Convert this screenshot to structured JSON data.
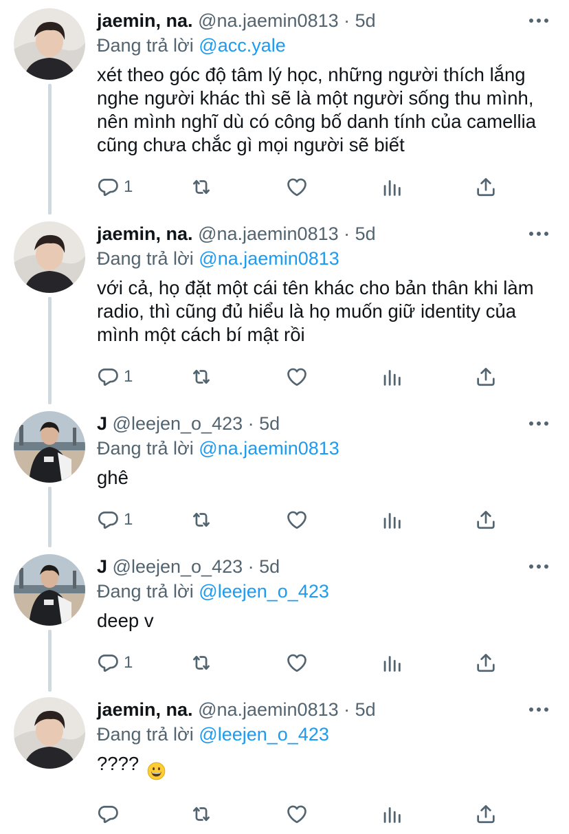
{
  "colors": {
    "text": "#0f1419",
    "secondary": "#536471",
    "link": "#1d9bf0",
    "thread_line": "#cfd9de"
  },
  "reply_prefix": "Đang trả lời",
  "tweets": [
    {
      "name": "jaemin, na.",
      "handle": "@na.jaemin0813",
      "time": "5d",
      "reply_to": "@acc.yale",
      "text": "xét theo góc độ tâm lý học, những người thích lắng nghe người khác thì sẽ là một người sống thu mình, nên mình nghĩ dù có công bố danh tính của camellia cũng chưa chắc gì mọi người sẽ biết",
      "reply_count": "1",
      "avatar": "avatar-jaemin"
    },
    {
      "name": "jaemin, na.",
      "handle": "@na.jaemin0813",
      "time": "5d",
      "reply_to": "@na.jaemin0813",
      "text": "với cả, họ đặt một cái tên khác cho bản thân khi làm radio, thì cũng đủ hiểu là họ muốn giữ identity của mình một cách bí mật rồi",
      "reply_count": "1",
      "avatar": "avatar-jaemin"
    },
    {
      "name": "J",
      "handle": "@leejen_o_423",
      "time": "5d",
      "reply_to": "@na.jaemin0813",
      "text": "ghê",
      "reply_count": "1",
      "avatar": "avatar-j"
    },
    {
      "name": "J",
      "handle": "@leejen_o_423",
      "time": "5d",
      "reply_to": "@leejen_o_423",
      "text": "deep v",
      "reply_count": "1",
      "avatar": "avatar-j"
    },
    {
      "name": "jaemin, na.",
      "handle": "@na.jaemin0813",
      "time": "5d",
      "reply_to": "@leejen_o_423",
      "text": "????",
      "emoji": "😀",
      "reply_count": "",
      "avatar": "avatar-jaemin"
    }
  ],
  "icons": {
    "more": "more-dots-icon",
    "reply": "reply-bubble-icon",
    "retweet": "retweet-icon",
    "like": "heart-icon",
    "views": "analytics-bars-icon",
    "share": "share-upload-icon"
  }
}
